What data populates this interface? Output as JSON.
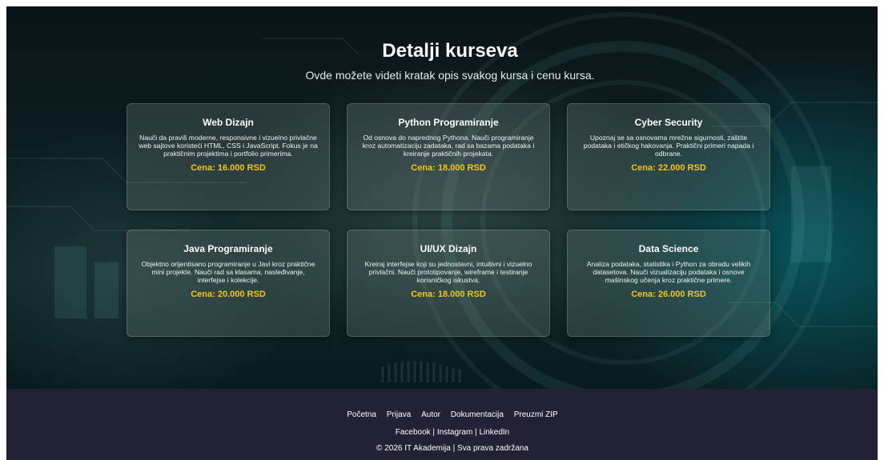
{
  "hero": {
    "title": "Detalji kurseva",
    "subtitle": "Ovde možete videti kratak opis svakog kursa i cenu kursa."
  },
  "courses": [
    {
      "title": "Web Dizajn",
      "description": "Nauči da praviš moderne, responsivne i vizuelno privlačne web sajtove koristeći HTML, CSS i JavaScript. Fokus je na praktičnim projektima i portfolio primerima.",
      "price": "Cena: 16.000 RSD"
    },
    {
      "title": "Python Programiranje",
      "description": "Od osnova do naprednog Pythona. Nauči programiranje kroz automatizaciju zadataka, rad sa bazama podataka i kreiranje praktičnih projekata.",
      "price": "Cena: 18.000 RSD"
    },
    {
      "title": "Cyber Security",
      "description": "Upoznaj se sa osnovama mrežne sigurnosti, zaštite podataka i etičkog hakovanja. Praktični primeri napada i odbrane.",
      "price": "Cena: 22.000 RSD"
    },
    {
      "title": "Java Programiranje",
      "description": "Objektno orijentisano programiranje u Javi kroz praktične mini projekte. Nauči rad sa klasama, nasleđivanje, interfejse i kolekcije.",
      "price": "Cena: 20.000 RSD"
    },
    {
      "title": "UI/UX Dizajn",
      "description": "Kreiraj interfejse koji su jednostavni, intuitivni i vizuelno privlačni. Nauči prototipovanje, wireframe i testiranje korisničkog iskustva.",
      "price": "Cena: 18.000 RSD"
    },
    {
      "title": "Data Science",
      "description": "Analiza podataka, statistika i Python za obradu velikih datasetova. Nauči vizualizaciju podataka i osnove mašinskog učenja kroz praktične primere.",
      "price": "Cena: 26.000 RSD"
    }
  ],
  "footer": {
    "nav": [
      "Početna",
      "Prijava",
      "Autor",
      "Dokumentacija",
      "Preuzmi ZIP"
    ],
    "social": [
      "Facebook",
      "Instagram",
      "LinkedIn"
    ],
    "separator": " | ",
    "copyright": "© 2026 IT Akademija | Sva prava zadržana"
  },
  "colors": {
    "price": "#f5c518",
    "footer_bg": "#232136",
    "hero_bg": "#0d1e22"
  }
}
